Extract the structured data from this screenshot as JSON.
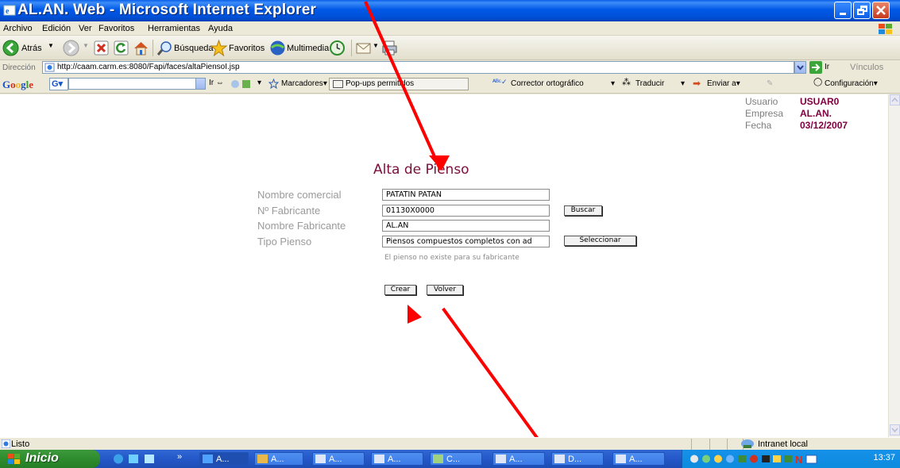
{
  "window": {
    "title": "AL.AN. Web - Microsoft Internet Explorer"
  },
  "menu": [
    "Archivo",
    "Edición",
    "Ver",
    "Favoritos",
    "Herramientas",
    "Ayuda"
  ],
  "toolbar": {
    "back": "Atrás",
    "search": "Búsqueda",
    "favorites": "Favoritos",
    "multimedia": "Multimedia"
  },
  "address": {
    "label": "Dirección",
    "url": "http://caam.carm.es:8080/Fapi/faces/altaPiensoI.jsp",
    "go": "Ir",
    "links": "Vínculos"
  },
  "google": {
    "logo": "Google",
    "go": "Ir",
    "bookmarks": "Marcadores",
    "popups": "Pop-ups permitidos",
    "spell": "Corrector ortográfico",
    "translate": "Traducir",
    "send": "Enviar a",
    "config": "Configuración"
  },
  "user": {
    "usuario_label": "Usuario",
    "usuario": "USUAR0",
    "empresa_label": "Empresa",
    "empresa": "AL.AN.",
    "fecha_label": "Fecha",
    "fecha": "03/12/2007"
  },
  "form": {
    "title": "Alta de Pienso",
    "nombre_comercial_label": "Nombre comercial",
    "nombre_comercial": "PATATIN PATAN",
    "num_fabricante_label": "Nº Fabricante",
    "num_fabricante": "01130X0000",
    "buscar": "Buscar",
    "nombre_fabricante_label": "Nombre Fabricante",
    "nombre_fabricante": "AL.AN",
    "tipo_pienso_label": "Tipo Pienso",
    "tipo_pienso": "Piensos compuestos  completos con ad",
    "seleccionar": "Seleccionar",
    "message": "El pienso no existe para su fabricante",
    "crear": "Crear",
    "volver": "Volver"
  },
  "status": {
    "text": "Listo",
    "zone": "Intranet local"
  },
  "taskbar": {
    "start": "Inicio",
    "more": "»",
    "tasks": [
      "A...",
      "A...",
      "A...",
      "A...",
      "C...",
      "A...",
      "D...",
      "A..."
    ],
    "clock": "13:37"
  },
  "colors": {
    "accent": "#800040",
    "title": "#7a0d3c",
    "annotation": "#ff0000"
  }
}
